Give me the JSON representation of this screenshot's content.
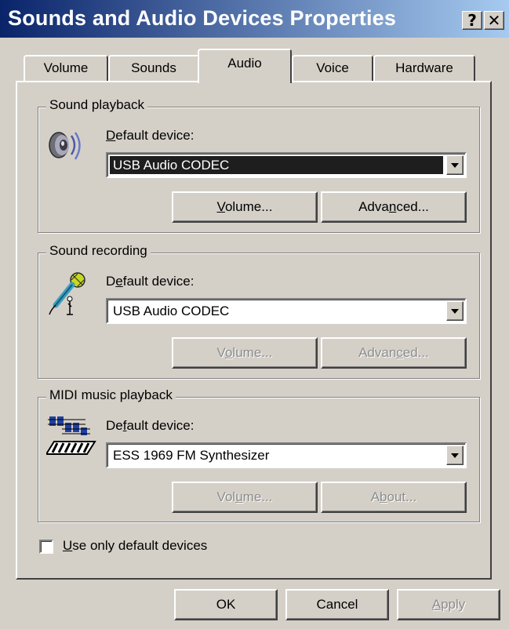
{
  "window": {
    "title": "Sounds and Audio Devices Properties",
    "help_label": "?",
    "close_label": "✕"
  },
  "tabs": [
    {
      "label": "Volume",
      "active": false
    },
    {
      "label": "Sounds",
      "active": false
    },
    {
      "label": "Audio",
      "active": true
    },
    {
      "label": "Voice",
      "active": false
    },
    {
      "label": "Hardware",
      "active": false
    }
  ],
  "playback": {
    "group_label": "Sound playback",
    "default_label_accel": "D",
    "default_label_rest": "efault device:",
    "device": "USB Audio CODEC",
    "volume_button": {
      "accel": "V",
      "rest": "olume...",
      "enabled": true
    },
    "advanced_button": {
      "pre": "Adva",
      "accel": "n",
      "rest": "ced...",
      "enabled": true
    }
  },
  "recording": {
    "group_label": "Sound recording",
    "default_label_pre": "D",
    "default_label_accel": "e",
    "default_label_rest": "fault device:",
    "device": "USB Audio CODEC",
    "volume_button": {
      "pre": "V",
      "accel": "o",
      "rest": "lume...",
      "enabled": false
    },
    "advanced_button": {
      "pre": "Advan",
      "accel": "c",
      "rest": "ed...",
      "enabled": false
    }
  },
  "midi": {
    "group_label": "MIDI music playback",
    "default_label_pre": "De",
    "default_label_accel": "f",
    "default_label_rest": "ault device:",
    "device": "ESS 1969 FM Synthesizer",
    "volume_button": {
      "pre": "Vol",
      "accel": "u",
      "rest": "me...",
      "enabled": false
    },
    "about_button": {
      "pre": "A",
      "accel": "b",
      "rest": "out...",
      "enabled": false
    }
  },
  "use_default": {
    "accel": "U",
    "rest": "se only default devices",
    "checked": false
  },
  "footer": {
    "ok_label": "OK",
    "cancel_label": "Cancel",
    "apply_accel": "A",
    "apply_rest": "pply"
  }
}
